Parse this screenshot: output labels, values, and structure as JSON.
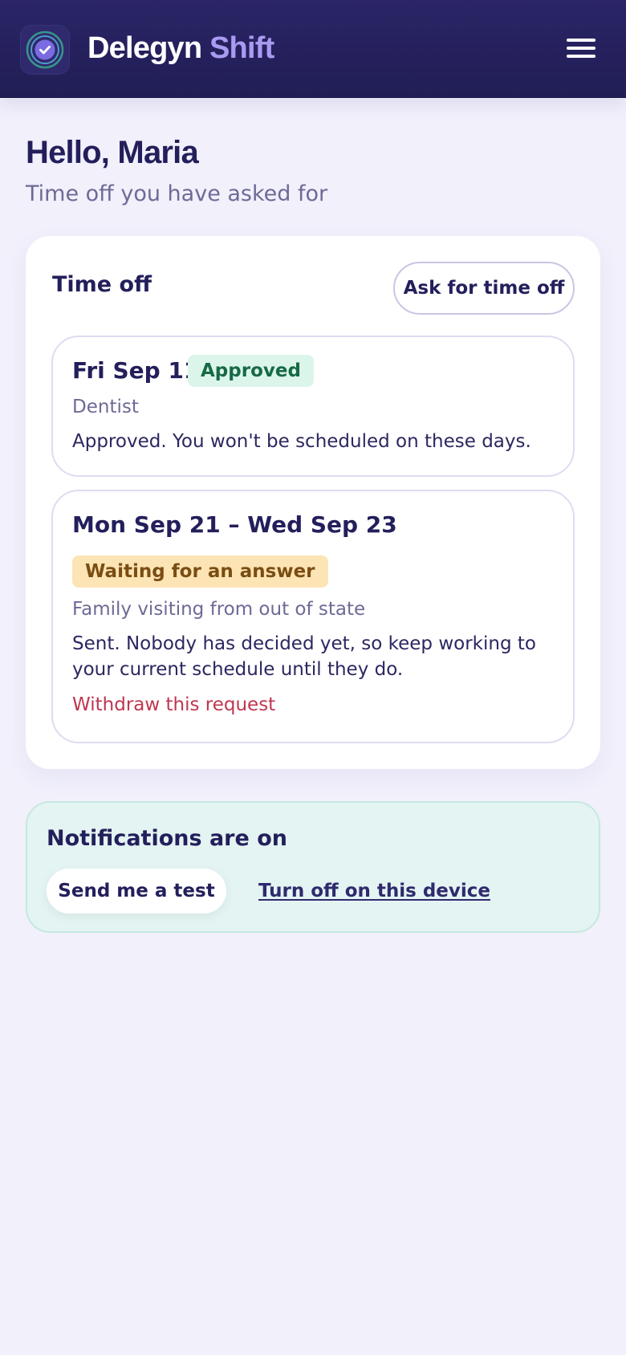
{
  "header": {
    "brand_primary": "Delegyn",
    "brand_accent": "Shift",
    "logo_icon": "check-target-icon",
    "menu_icon": "hamburger-menu-icon"
  },
  "greeting": {
    "title": "Hello, Maria",
    "subtitle": "Time off you have asked for"
  },
  "time_off": {
    "title": "Time off",
    "ask_button_label": "Ask for time off",
    "requests": [
      {
        "dates": "Fri Sep 11",
        "status": "Approved",
        "reason": "Dentist",
        "note": "Approved. You won't be scheduled on these days."
      },
      {
        "dates": "Mon Sep 21 – Wed Sep 23",
        "status": "Waiting for an answer",
        "reason": "Family visiting from out of state",
        "note": "Sent. Nobody has decided yet, so keep working to your current schedule until they do.",
        "action_label": "Withdraw this request"
      }
    ]
  },
  "notifications": {
    "title": "Notifications are on",
    "test_button_label": "Send me a test",
    "turn_off_label": "Turn off on this device"
  },
  "colors": {
    "header_bg": "#221e57",
    "brand_accent": "#a99af2",
    "page_bg": "#f1f0fb",
    "approved_bg": "#dcf5ea",
    "approved_text": "#166a45",
    "pending_bg": "#fde4b4",
    "pending_text": "#7a4d12",
    "danger_text": "#c0364f",
    "notify_bg": "#e4f4f2"
  }
}
